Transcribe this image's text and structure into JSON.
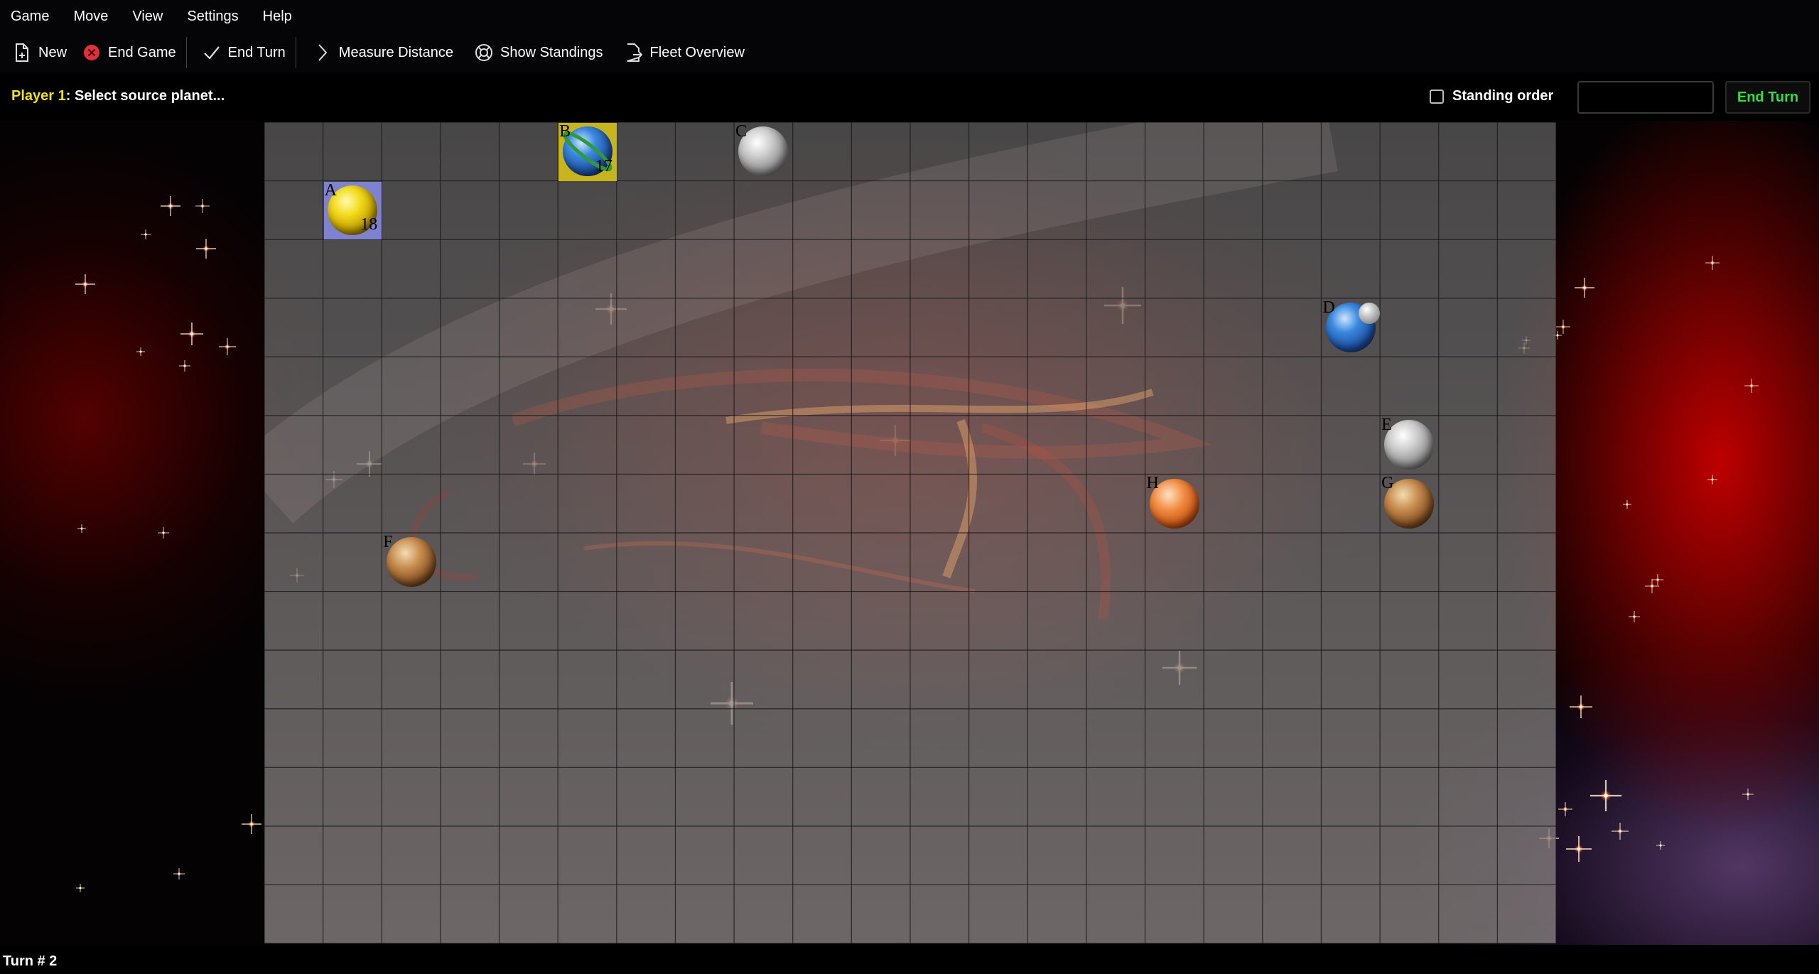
{
  "menubar": {
    "items": [
      "Game",
      "Move",
      "View",
      "Settings",
      "Help"
    ]
  },
  "toolbar": {
    "new_label": "New",
    "end_game_label": "End Game",
    "end_turn_label": "End Turn",
    "measure_label": "Measure Distance",
    "standings_label": "Show Standings",
    "fleet_label": "Fleet Overview"
  },
  "status": {
    "player": "Player 1",
    "prompt": ": Select source planet...",
    "standing_order_label": "Standing order",
    "order_input_value": "",
    "end_turn_label": "End Turn"
  },
  "board": {
    "columns": 22,
    "rows": 14,
    "planets": [
      {
        "label": "A",
        "col": 1,
        "row": 1,
        "ships": "18",
        "style": "yellow",
        "owner_color": "#7f82cf"
      },
      {
        "label": "B",
        "col": 5,
        "row": 0,
        "ships": "17",
        "style": "blue-ring",
        "owner_color": "#c8b41c"
      },
      {
        "label": "C",
        "col": 8,
        "row": 0,
        "ships": "",
        "style": "gray",
        "owner_color": ""
      },
      {
        "label": "D",
        "col": 18,
        "row": 3,
        "ships": "",
        "style": "blue-moon",
        "owner_color": ""
      },
      {
        "label": "E",
        "col": 19,
        "row": 5,
        "ships": "",
        "style": "gray",
        "owner_color": ""
      },
      {
        "label": "F",
        "col": 2,
        "row": 7,
        "ships": "",
        "style": "brown",
        "owner_color": ""
      },
      {
        "label": "G",
        "col": 19,
        "row": 6,
        "ships": "",
        "style": "brown",
        "owner_color": ""
      },
      {
        "label": "H",
        "col": 15,
        "row": 6,
        "ships": "",
        "style": "orange",
        "owner_color": ""
      }
    ]
  },
  "footer": {
    "turn": "Turn # 2"
  },
  "colors": {
    "player_highlight": "#f0e020",
    "end_turn_text": "#33dd44",
    "end_game_icon": "#e0303a"
  }
}
